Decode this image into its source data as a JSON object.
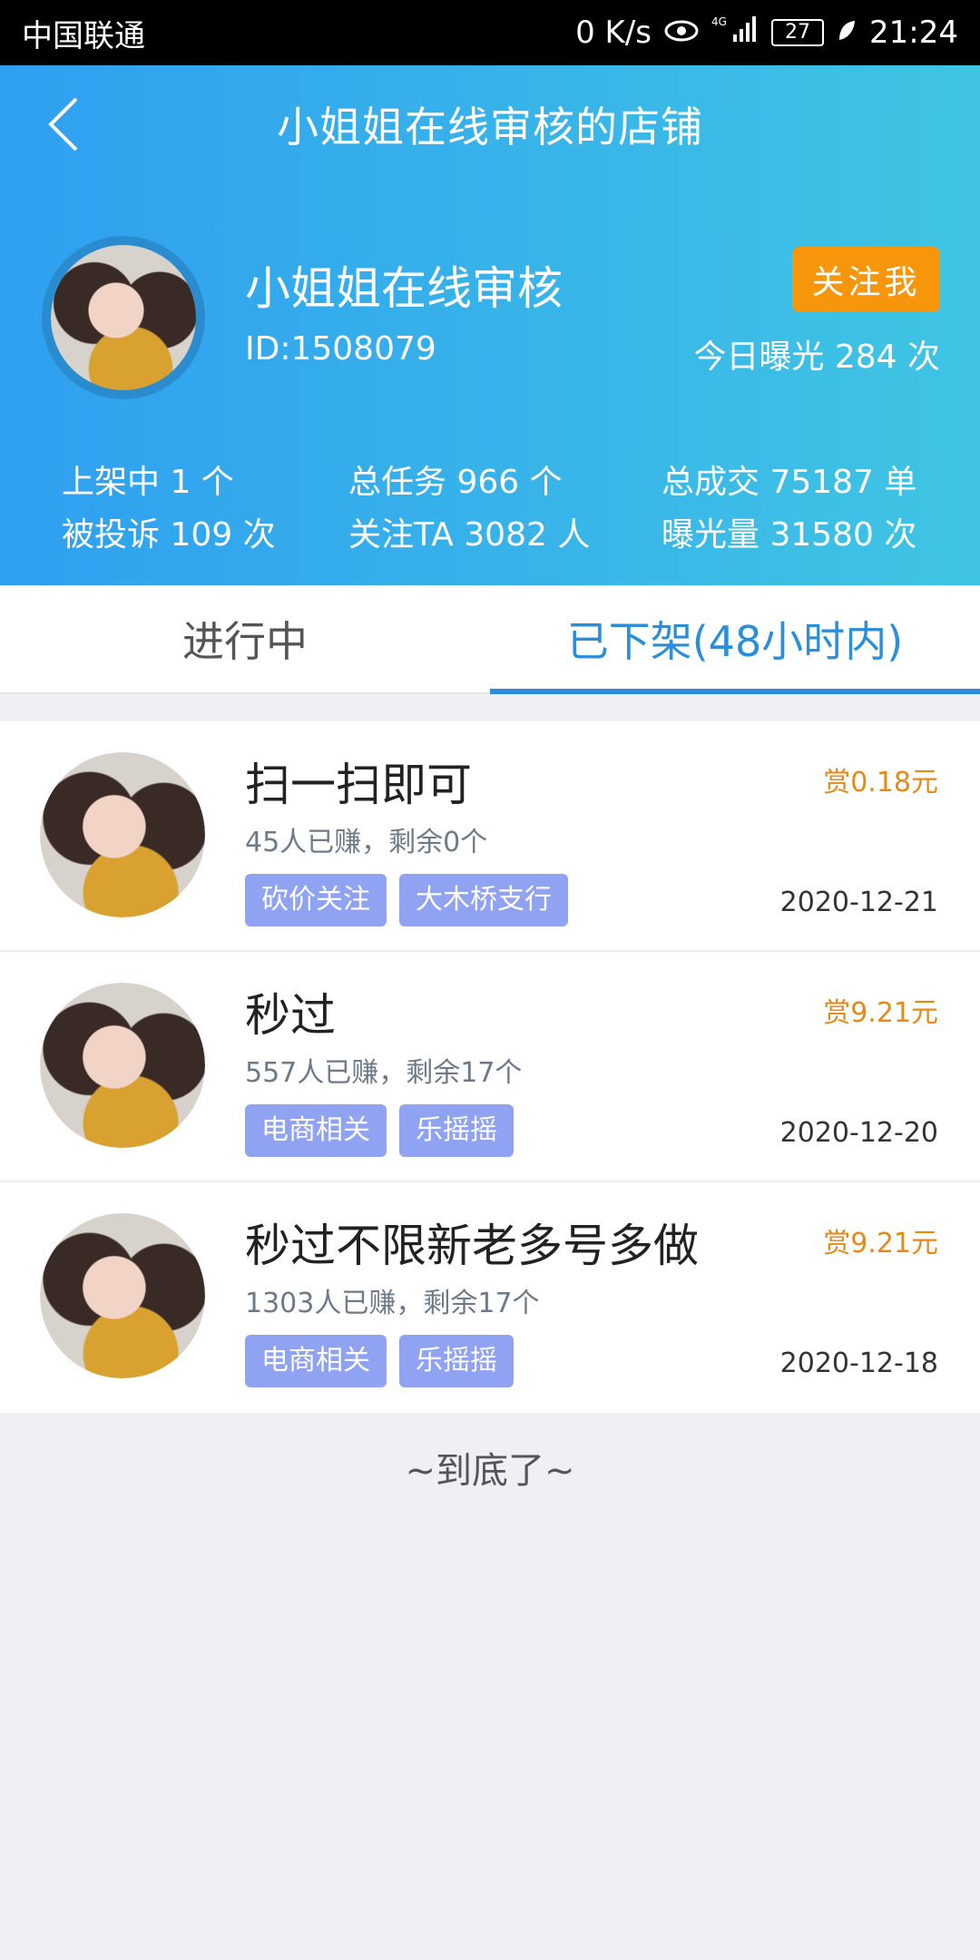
{
  "statusbar": {
    "carrier": "中国联通",
    "speed": "0 K/s",
    "network": "4G",
    "battery": "27",
    "time": "21:24"
  },
  "header": {
    "title": "小姐姐在线审核的店铺"
  },
  "shop": {
    "name": "小姐姐在线审核",
    "id": "ID:1508079",
    "follow_label": "关注我",
    "exposure_today": "今日曝光 284 次"
  },
  "stats": {
    "on_shelf": "上架中 1 个",
    "complaints": "被投诉 109 次",
    "total_tasks": "总任务 966 个",
    "followers": "关注TA 3082 人",
    "total_deals": "总成交 75187 单",
    "exposure_total": "曝光量 31580 次"
  },
  "tabs": [
    {
      "label": "进行中",
      "active": false
    },
    {
      "label": "已下架(48小时内)",
      "active": true
    }
  ],
  "tasks": [
    {
      "title": "扫一扫即可",
      "meta": "45人已赚，剩余0个",
      "tags": [
        "砍价关注",
        "大木桥支行"
      ],
      "reward": "赏0.18元",
      "date": "2020-12-21"
    },
    {
      "title": "秒过",
      "meta": "557人已赚，剩余17个",
      "tags": [
        "电商相关",
        "乐摇摇"
      ],
      "reward": "赏9.21元",
      "date": "2020-12-20"
    },
    {
      "title": "秒过不限新老多号多做",
      "meta": "1303人已赚，剩余17个",
      "tags": [
        "电商相关",
        "乐摇摇"
      ],
      "reward": "赏9.21元",
      "date": "2020-12-18"
    }
  ],
  "footer": {
    "end_text": "~到底了~"
  }
}
